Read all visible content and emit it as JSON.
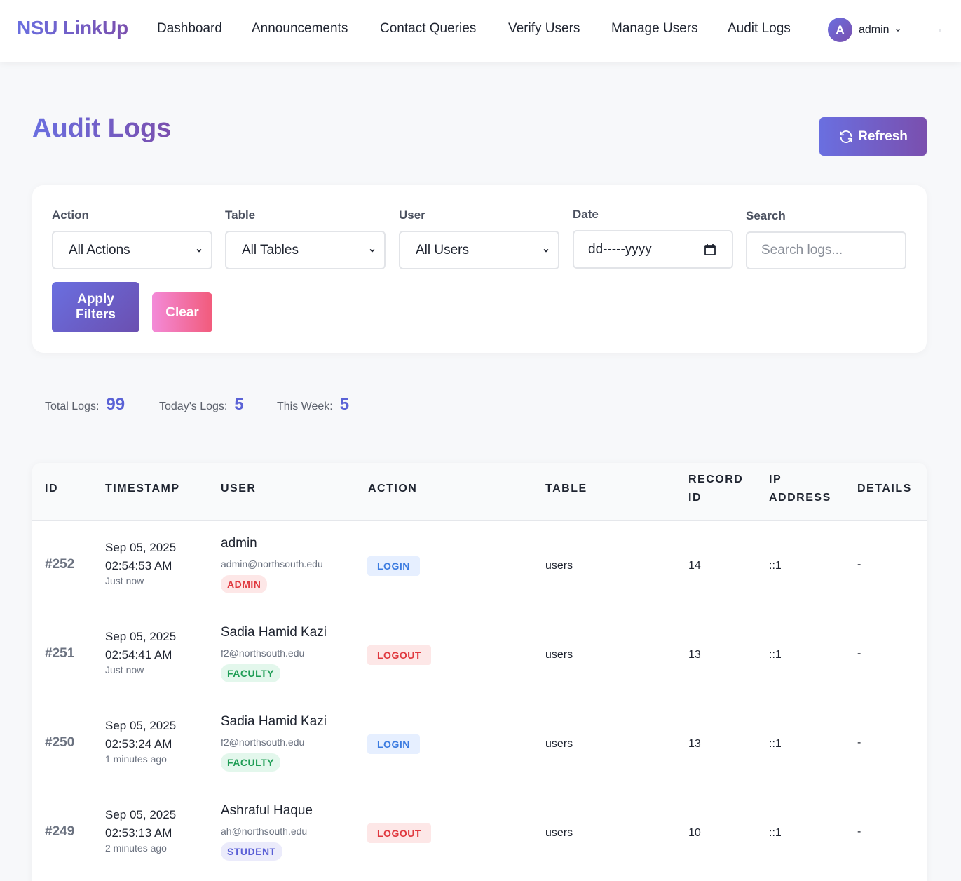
{
  "nav": {
    "brand": "NSU LinkUp",
    "links": [
      "Dashboard",
      "Announcements",
      "Contact Queries",
      "Verify Users",
      "Manage Users",
      "Audit Logs"
    ],
    "user": {
      "initial": "A",
      "name": "admin"
    }
  },
  "page": {
    "title": "Audit Logs",
    "refresh_label": "Refresh"
  },
  "filters": {
    "action": {
      "label": "Action",
      "value": "All Actions"
    },
    "table": {
      "label": "Table",
      "value": "All Tables"
    },
    "user": {
      "label": "User",
      "value": "All Users"
    },
    "date": {
      "label": "Date",
      "value": "dd-----yyyy"
    },
    "search": {
      "label": "Search",
      "placeholder": "Search logs..."
    },
    "apply_label": "Apply Filters",
    "clear_label": "Clear"
  },
  "stats": {
    "total_label": "Total Logs:",
    "total": "99",
    "today_label": "Today's Logs:",
    "today": "5",
    "week_label": "This Week:",
    "week": "5"
  },
  "table": {
    "headers": [
      "ID",
      "TIMESTAMP",
      "USER",
      "ACTION",
      "TABLE",
      "RECORD ID",
      "IP ADDRESS",
      "DETAILS"
    ],
    "rows": [
      {
        "id": "#252",
        "date": "Sep 05, 2025",
        "time": "02:54:53 AM",
        "ago": "Just now",
        "name": "admin",
        "email": "admin@northsouth.edu",
        "role": "ADMIN",
        "action": "LOGIN",
        "table": "users",
        "record": "14",
        "ip": "::1",
        "details": "-"
      },
      {
        "id": "#251",
        "date": "Sep 05, 2025",
        "time": "02:54:41 AM",
        "ago": "Just now",
        "name": "Sadia Hamid Kazi",
        "email": "f2@northsouth.edu",
        "role": "FACULTY",
        "action": "LOGOUT",
        "table": "users",
        "record": "13",
        "ip": "::1",
        "details": "-"
      },
      {
        "id": "#250",
        "date": "Sep 05, 2025",
        "time": "02:53:24 AM",
        "ago": "1 minutes ago",
        "name": "Sadia Hamid Kazi",
        "email": "f2@northsouth.edu",
        "role": "FACULTY",
        "action": "LOGIN",
        "table": "users",
        "record": "13",
        "ip": "::1",
        "details": "-"
      },
      {
        "id": "#249",
        "date": "Sep 05, 2025",
        "time": "02:53:13 AM",
        "ago": "2 minutes ago",
        "name": "Ashraful Haque",
        "email": "ah@northsouth.edu",
        "role": "STUDENT",
        "action": "LOGOUT",
        "table": "users",
        "record": "10",
        "ip": "::1",
        "details": "-"
      }
    ]
  },
  "colors": {
    "role_admin_bg": "#fde7e7",
    "role_admin_fg": "#e0383e",
    "role_faculty_bg": "#e3f7ec",
    "role_faculty_fg": "#1f9d55",
    "role_student_bg": "#ebebfb",
    "role_student_fg": "#5a5fd6",
    "login_bg": "#e6efff",
    "login_fg": "#3b7be0",
    "logout_bg": "#fde7e7",
    "logout_fg": "#e0383e"
  }
}
